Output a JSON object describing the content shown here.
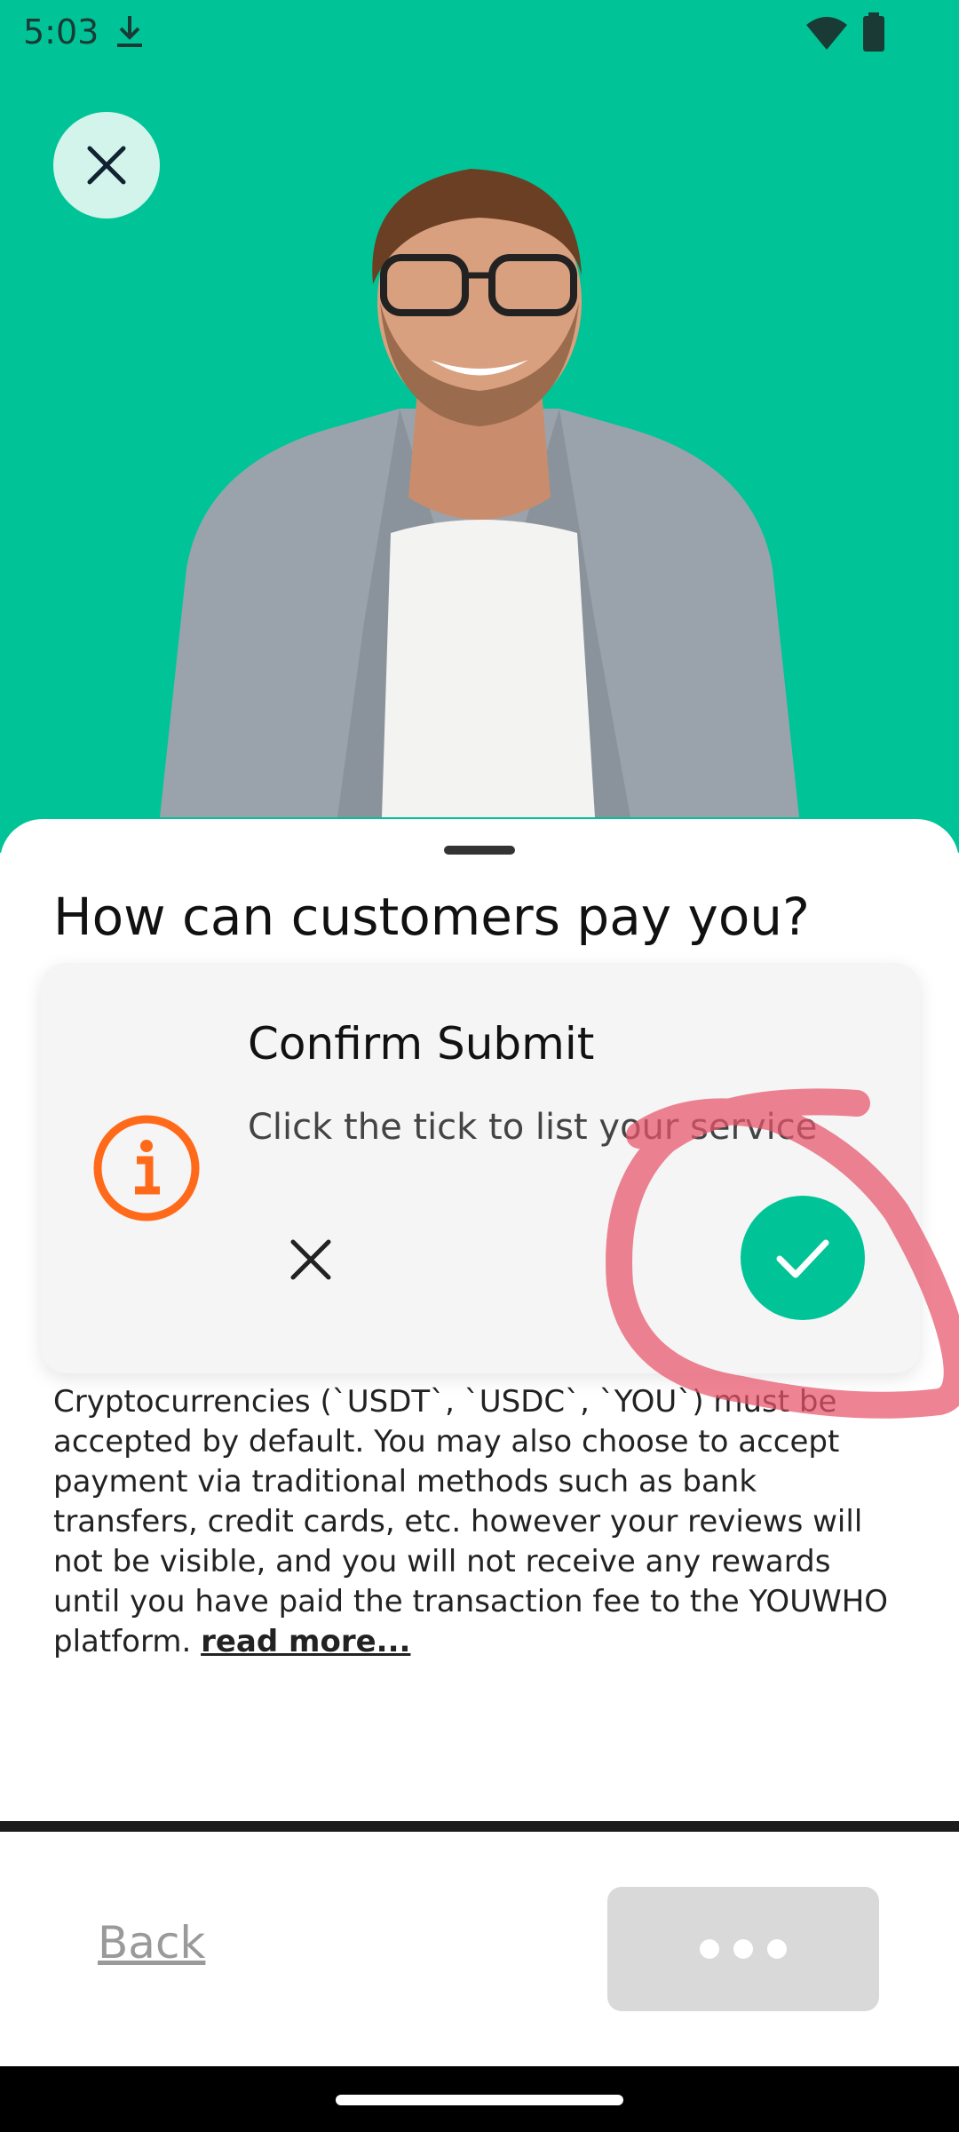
{
  "status_bar": {
    "time": "5:03"
  },
  "header": {
    "close_icon": "close-icon"
  },
  "sheet": {
    "title": "How can customers pay you?",
    "paragraph": "Cryptocurrencies (`USDT`, `USDC`, `YOU`) must be accepted by default. You may also choose to accept payment via traditional methods such as bank transfers, credit cards, etc. however your reviews will not be visible, and you will not receive any rewards until you have paid the transaction fee to the YOUWHO platform.",
    "read_more": "read more..."
  },
  "dialog": {
    "title": "Confirm Submit",
    "message": "Click the tick to list your service",
    "info_icon": "info-icon",
    "cancel_icon": "close-icon",
    "confirm_icon": "check-icon"
  },
  "footer": {
    "back_label": "Back",
    "more_icon": "more-dots-icon"
  },
  "colors": {
    "accent": "#00c497",
    "info": "#ff6a1a",
    "annotation": "#e8546a"
  }
}
